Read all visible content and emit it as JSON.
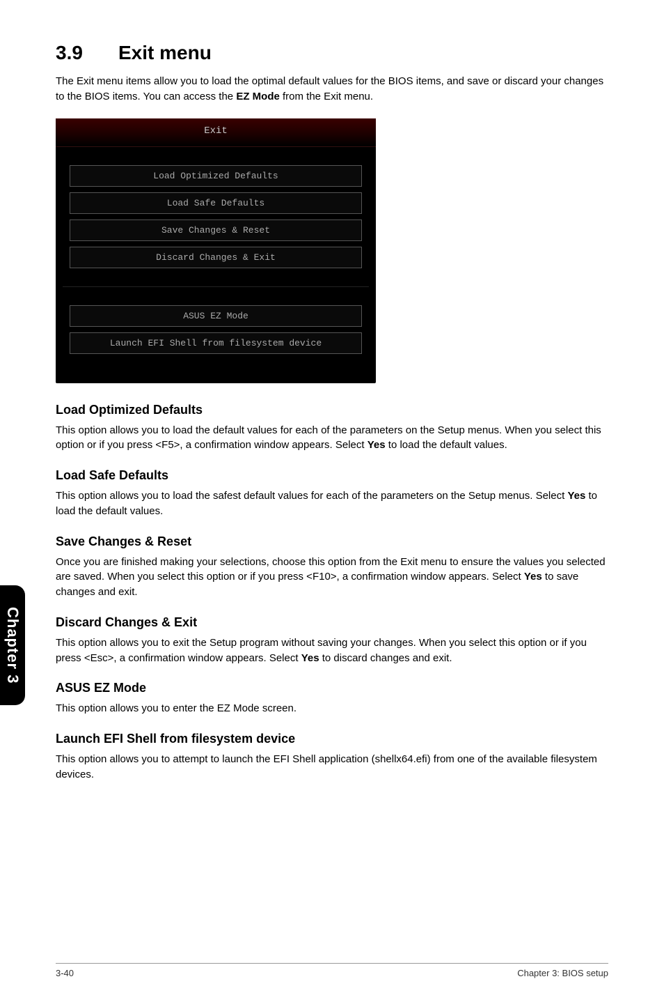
{
  "sidebar": {
    "label": "Chapter 3"
  },
  "title": {
    "num": "3.9",
    "text": "Exit menu"
  },
  "intro": {
    "text_before": "The Exit menu items allow you to load the optimal default values for the BIOS items, and save or discard your changes to the BIOS items. You can access the ",
    "bold": "EZ Mode",
    "text_after": " from the Exit menu."
  },
  "bios": {
    "header": "Exit",
    "buttons_top": [
      "Load Optimized Defaults",
      "Load Safe Defaults",
      "Save Changes & Reset",
      "Discard Changes & Exit"
    ],
    "buttons_bottom": [
      "ASUS EZ Mode",
      "Launch EFI Shell from filesystem device"
    ]
  },
  "sections": [
    {
      "heading": "Load Optimized Defaults",
      "body": "This option allows you to load the default values for each of the parameters on the Setup menus. When you select this option or if you press <F5>, a confirmation window appears. Select ",
      "bold": "Yes",
      "tail": " to load the default values."
    },
    {
      "heading": "Load Safe Defaults",
      "body": "This option allows you to load the safest default values for each of the parameters on the Setup menus. Select ",
      "bold": "Yes",
      "tail": " to load the default values."
    },
    {
      "heading": "Save Changes & Reset",
      "body": "Once you are finished making your selections, choose this option from the Exit menu to ensure the values you selected are saved. When you select this option or if you press <F10>, a confirmation window appears. Select ",
      "bold": "Yes",
      "tail": " to save changes and exit."
    },
    {
      "heading": "Discard Changes & Exit",
      "body": "This option allows you to exit the Setup program without saving your changes. When you select this option or if you press <Esc>, a confirmation window appears. Select ",
      "bold": "Yes",
      "tail": " to discard changes and exit."
    },
    {
      "heading": "ASUS EZ Mode",
      "body": "This option allows you to enter the EZ Mode screen.",
      "bold": "",
      "tail": ""
    },
    {
      "heading": "Launch EFI Shell from filesystem device",
      "body": "This option allows you to attempt to launch the EFI Shell application (shellx64.efi) from one of the available filesystem devices.",
      "bold": "",
      "tail": ""
    }
  ],
  "footer": {
    "left": "3-40",
    "right": "Chapter 3: BIOS setup"
  }
}
